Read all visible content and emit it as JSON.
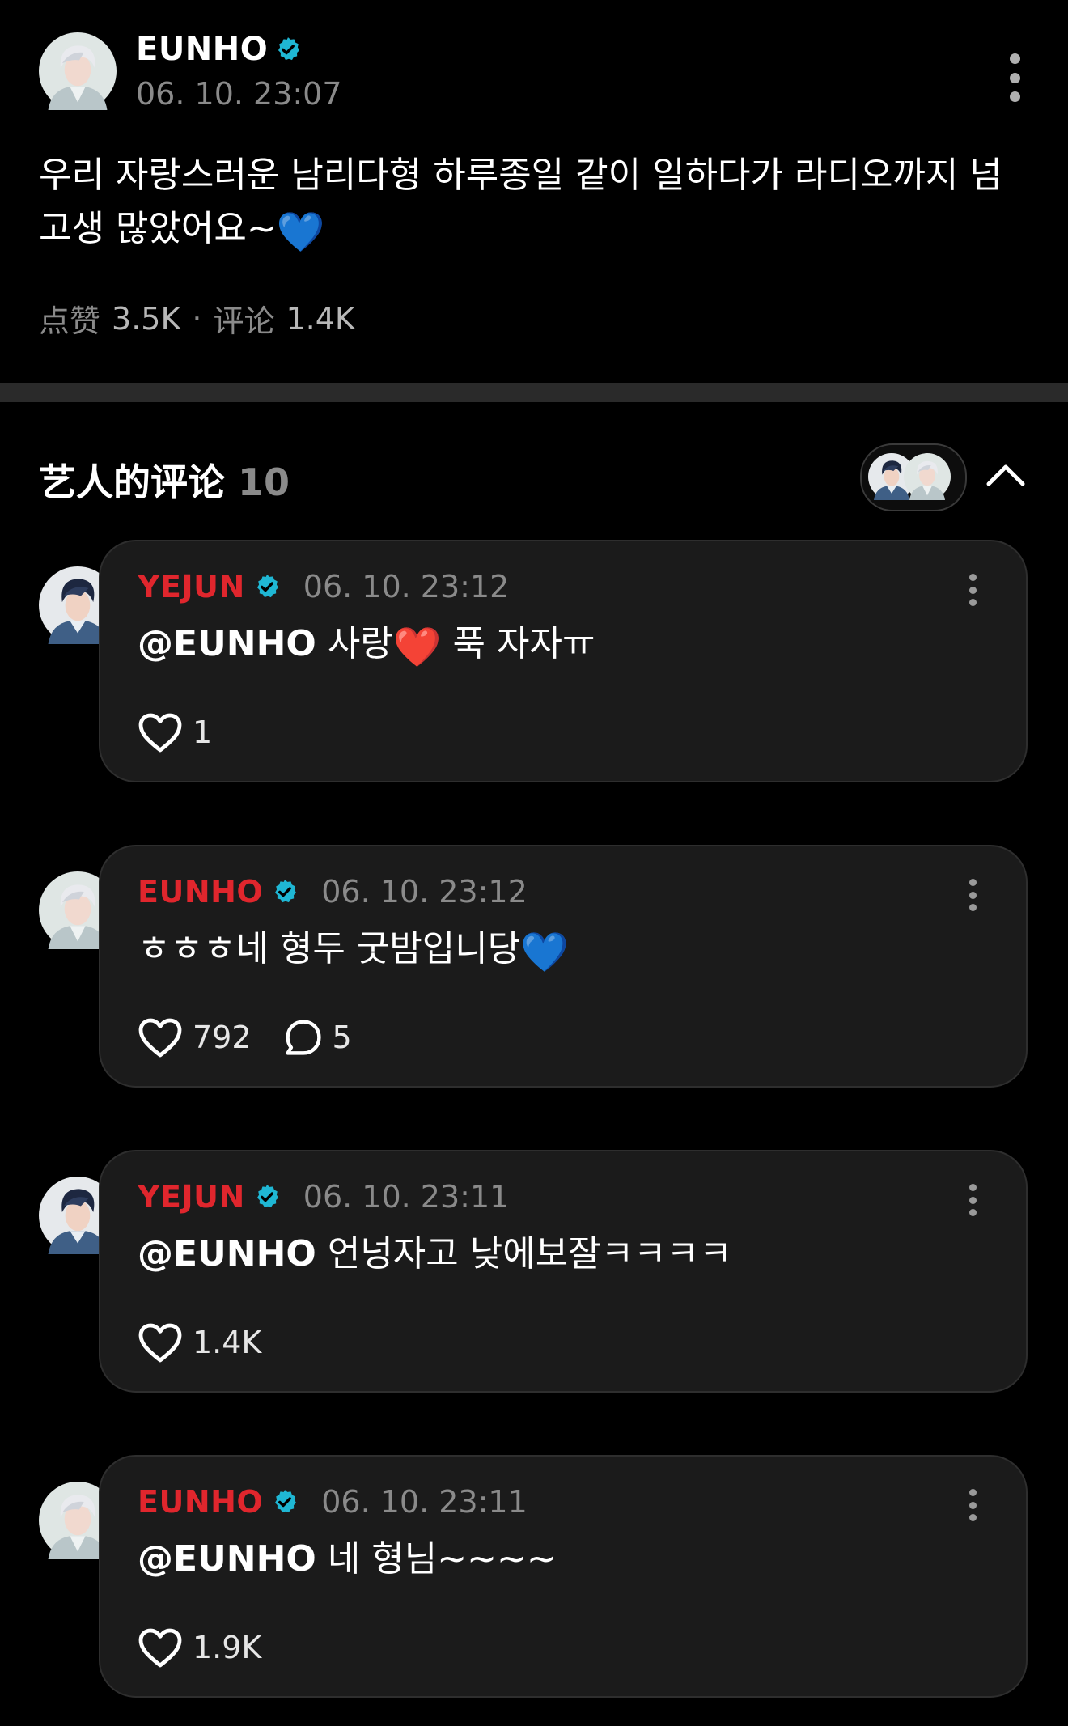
{
  "post": {
    "author": "EUNHO",
    "time": "06. 10. 23:07",
    "text": "우리 자랑스러운 남리다형 하루종일 같이 일하다가 라디오까지 넘 고생 많았어요~",
    "text_emoji": "💙",
    "likes_label": "点赞",
    "likes": "3.5K",
    "separator": "·",
    "comments_label": "评论",
    "comments": "1.4K"
  },
  "artist_comments": {
    "title": "艺人的评论",
    "count": "10"
  },
  "comments": [
    {
      "author": "YEJUN",
      "time": "06. 10. 23:12",
      "mention": "@EUNHO",
      "text": " 사랑",
      "emoji": "❤️",
      "text2": " 푹 자자ㅠ",
      "likes": "1",
      "replies": ""
    },
    {
      "author": "EUNHO",
      "time": "06. 10. 23:12",
      "mention": "",
      "text": "ㅎㅎㅎ네 형두 굿밤입니당",
      "emoji": "💙",
      "text2": "",
      "likes": "792",
      "replies": "5"
    },
    {
      "author": "YEJUN",
      "time": "06. 10. 23:11",
      "mention": "@EUNHO",
      "text": " 언넝자고 낮에보잘ㅋㅋㅋㅋ",
      "emoji": "",
      "text2": "",
      "likes": "1.4K",
      "replies": ""
    },
    {
      "author": "EUNHO",
      "time": "06. 10. 23:11",
      "mention": "@EUNHO",
      "text": " 네 형님~~~~",
      "emoji": "",
      "text2": "",
      "likes": "1.9K",
      "replies": ""
    }
  ],
  "colors": {
    "background": "#000000",
    "card": "#1b1b1b",
    "artist_name": "#e0262d",
    "verified": "#1fb7d4",
    "muted": "#8a8a8a"
  },
  "icons": [
    "verified-icon",
    "more-icon",
    "heart-icon",
    "comment-icon",
    "chevron-up-icon"
  ]
}
